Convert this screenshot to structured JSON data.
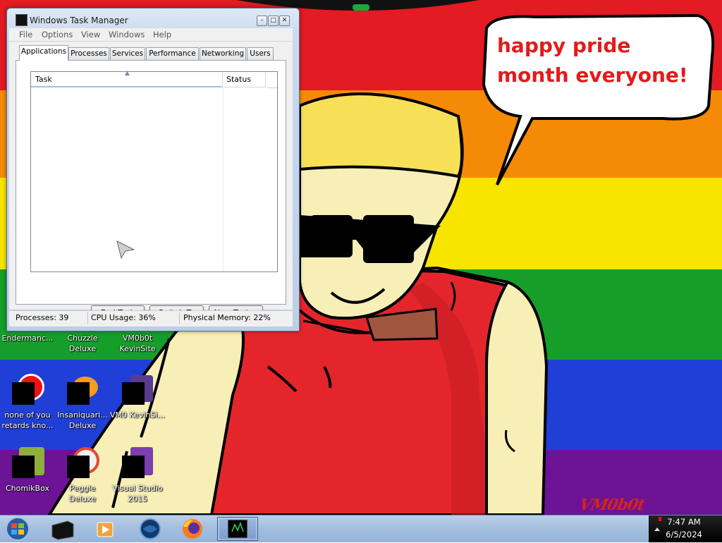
{
  "desktop": {
    "speech_bubble_text": "happy pride month everyone!",
    "watermark": "VM0b0t",
    "stripe_colors": [
      "#e31b22",
      "#f58a07",
      "#f7e500",
      "#159f2a",
      "#1f3fd6",
      "#6c1396"
    ],
    "icons": [
      {
        "label": "Endermanc...",
        "icon": "game-icon"
      },
      {
        "label": "Chuzzle Deluxe",
        "icon": "chuzzle-icon"
      },
      {
        "label": "VM0b0t KevinSite",
        "icon": "shortcut-icon"
      },
      {
        "label": "none of you retards kno...",
        "icon": "red-circle-icon"
      },
      {
        "label": "Insaniquari... Deluxe",
        "icon": "insaniquarium-icon"
      },
      {
        "label": "VM0 KevinSi...",
        "icon": "shortcut-icon"
      },
      {
        "label": "ChomikBox",
        "icon": "chomikbox-icon"
      },
      {
        "label": "Peggle Deluxe",
        "icon": "peggle-icon"
      },
      {
        "label": "Visual Studio 2015",
        "icon": "visual-studio-icon"
      }
    ]
  },
  "task_manager": {
    "title": "Windows Task Manager",
    "menu": [
      "File",
      "Options",
      "View",
      "Windows",
      "Help"
    ],
    "tabs": [
      "Applications",
      "Processes",
      "Services",
      "Performance",
      "Networking",
      "Users"
    ],
    "active_tab": "Applications",
    "columns": {
      "task": "Task",
      "status": "Status"
    },
    "buttons": {
      "end_task": "End Task",
      "switch_to": "Switch To",
      "new_task": "New Task..."
    },
    "status": {
      "processes": "Processes: 39",
      "cpu": "CPU Usage: 36%",
      "memory": "Physical Memory: 22%"
    }
  },
  "taskbar": {
    "items": [
      "start-orb-icon",
      "folder-icon",
      "media-player-icon",
      "globe-icon",
      "firefox-icon",
      "task-manager-icon"
    ],
    "time": "7:47 AM",
    "date": "6/5/2024"
  }
}
